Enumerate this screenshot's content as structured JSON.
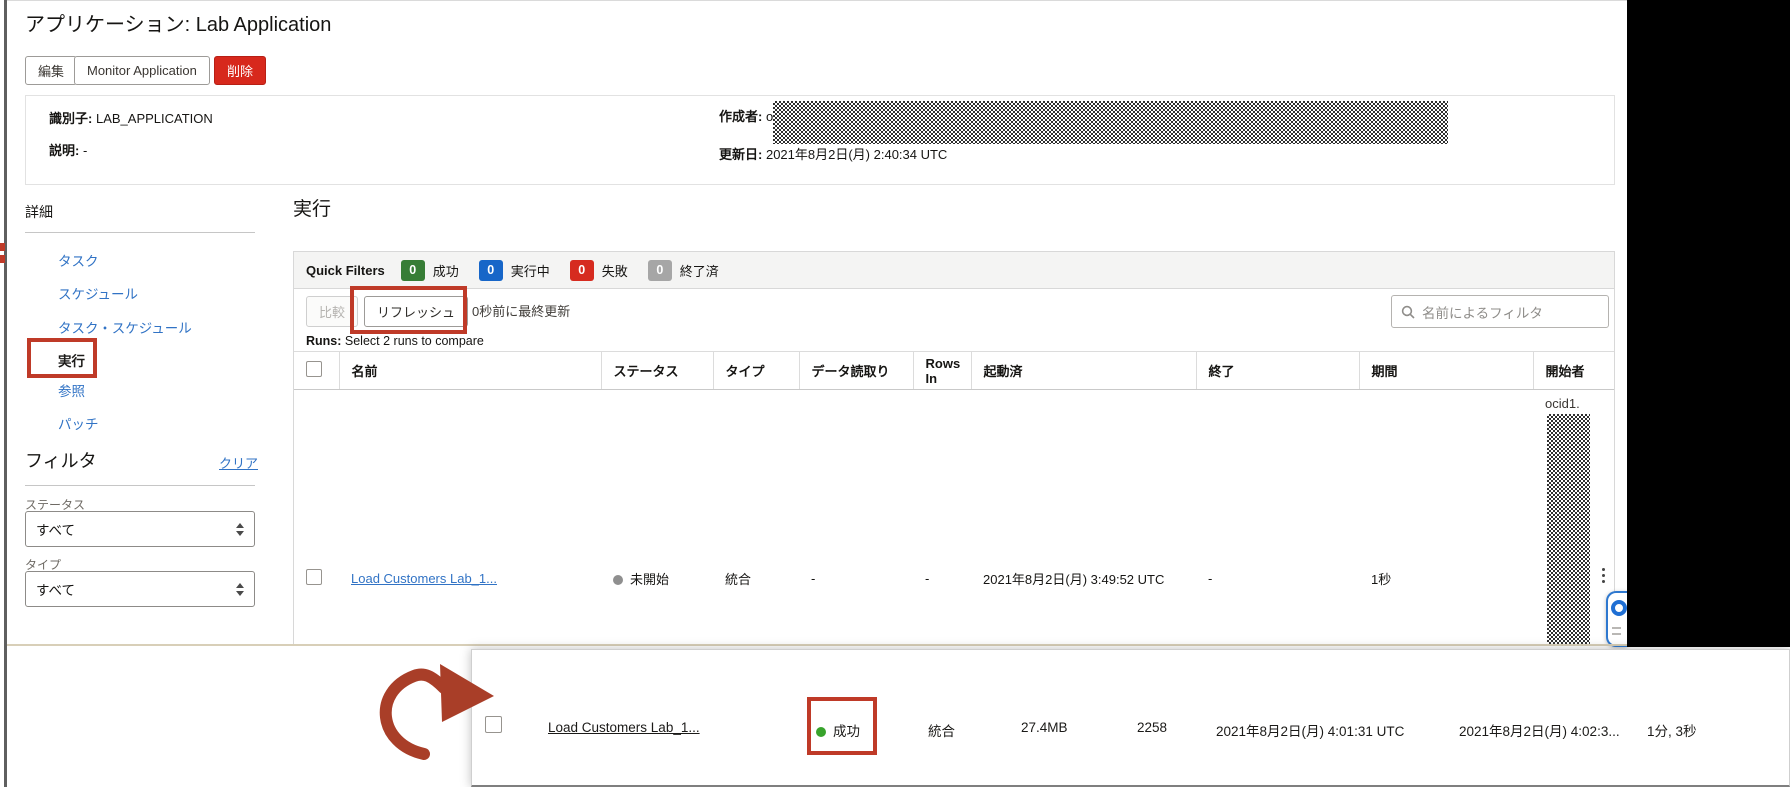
{
  "colors": {
    "annotation_red": "#bf3a28",
    "danger_button_red": "#d7281c",
    "badge_green": "#377d36",
    "badge_blue": "#1766c8",
    "badge_red": "#d62b1f",
    "badge_gray": "#a6a6a6",
    "link_blue": "#3173c5",
    "success_dot_green": "#38a32c",
    "not_started_dot_gray": "#8f8f8f"
  },
  "header": {
    "title": "アプリケーション: Lab Application",
    "edit_button": "編集",
    "monitor_button": "Monitor Application",
    "delete_button": "削除"
  },
  "info": {
    "identifier_label": "識別子:",
    "identifier_value": "LAB_APPLICATION",
    "description_label": "説明:",
    "description_value": "-",
    "creator_label": "作成者:",
    "creator_value_prefix": "o",
    "updated_label": "更新日:",
    "updated_value": "2021年8月2日(月) 2:40:34 UTC"
  },
  "sidebar": {
    "details_heading": "詳細",
    "items": [
      {
        "label": "タスク"
      },
      {
        "label": "スケジュール"
      },
      {
        "label": "タスク・スケジュール"
      },
      {
        "label": "実行"
      },
      {
        "label": "参照"
      },
      {
        "label": "パッチ"
      }
    ],
    "filter_heading": "フィルタ",
    "clear_link": "クリア",
    "status_label": "ステータス",
    "status_value": "すべて",
    "type_label": "タイプ",
    "type_value": "すべて"
  },
  "main": {
    "heading": "実行",
    "quick_filters": {
      "label": "Quick Filters",
      "items": [
        {
          "count": "0",
          "label": "成功"
        },
        {
          "count": "0",
          "label": "実行中"
        },
        {
          "count": "0",
          "label": "失敗"
        },
        {
          "count": "0",
          "label": "終了済"
        }
      ]
    },
    "toolbar": {
      "compare_button": "比較",
      "refresh_button": "リフレッシュ",
      "last_updated": "0秒前に最終更新",
      "search_placeholder": "名前によるフィルタ"
    },
    "runs_hint_label": "Runs:",
    "runs_hint_text": " Select 2 runs to compare",
    "table": {
      "columns": [
        "名前",
        "ステータス",
        "タイプ",
        "データ読取り",
        "Rows In",
        "起動済",
        "終了",
        "期間",
        "開始者"
      ],
      "rows": [
        {
          "name": "Load Customers Lab_1...",
          "status": "未開始",
          "type": "統合",
          "data_read": "-",
          "rows_in": "-",
          "started": "2021年8月2日(月) 3:49:52 UTC",
          "ended": "-",
          "duration": "1秒",
          "initiated_by_prefix": "ocid1."
        }
      ]
    }
  },
  "overlay_row": {
    "name": "Load Customers Lab_1...",
    "status": "成功",
    "type": "統合",
    "data_read": "27.4MB",
    "rows_in": "2258",
    "started": "2021年8月2日(月) 4:01:31 UTC",
    "ended": "2021年8月2日(月) 4:02:3...",
    "duration": "1分, 3秒"
  }
}
